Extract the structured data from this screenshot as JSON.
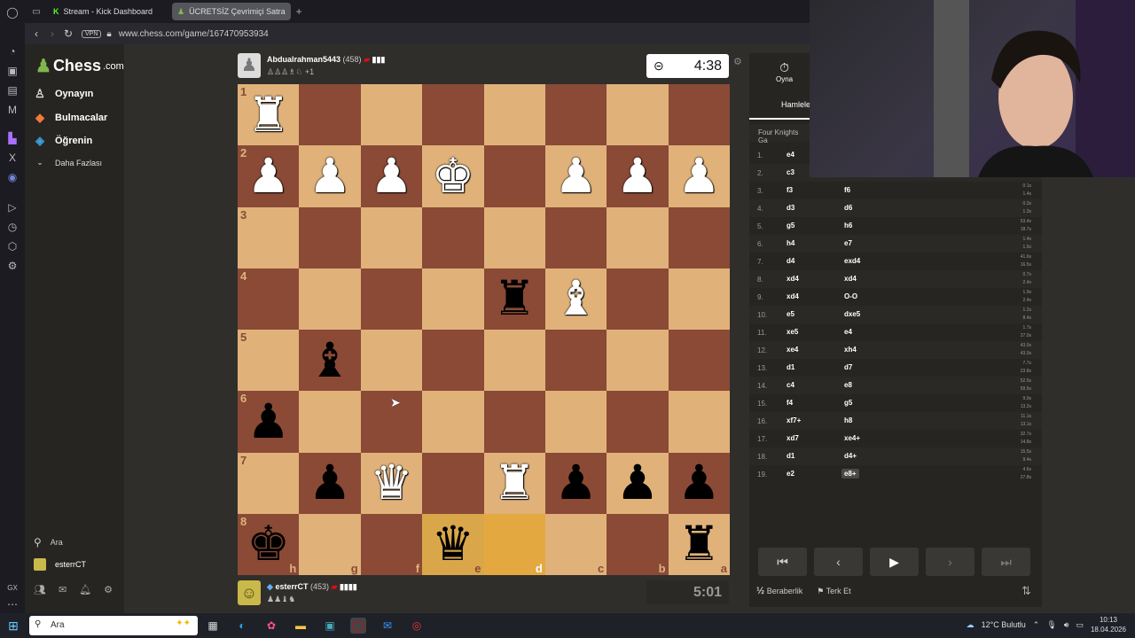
{
  "browser": {
    "tabs": [
      {
        "label": "Stream - Kick Dashboard",
        "active": false
      },
      {
        "label": "ÜCRETSİZ Çevrimiçi Satra",
        "active": true
      }
    ],
    "vpn": "VPN",
    "url": "www.chess.com/game/167470953934"
  },
  "sidebar": {
    "logo": "Chess",
    "logo_suffix": ".com",
    "items": [
      {
        "label": "Oynayın",
        "icon": "pawn-board-icon"
      },
      {
        "label": "Bulmacalar",
        "icon": "puzzle-icon"
      },
      {
        "label": "Öğrenin",
        "icon": "learn-cap-icon"
      },
      {
        "label": "Daha Fazlası",
        "icon": "chevron-down-icon"
      }
    ],
    "search_label": "Ara",
    "user": "esterrCT"
  },
  "top_player": {
    "name": "Abdualrahman5443",
    "rating": "(458)",
    "captured_extra": "+1",
    "clock": "4:38"
  },
  "bottom_player": {
    "name": "esterrCT",
    "rating": "(453)",
    "clock": "5:01"
  },
  "board": {
    "ranks": [
      "1",
      "2",
      "3",
      "4",
      "5",
      "6",
      "7",
      "8"
    ],
    "files": [
      "h",
      "g",
      "f",
      "e",
      "d",
      "c",
      "b",
      "a"
    ],
    "rows": [
      [
        "wR",
        "",
        "",
        "",
        "",
        "",
        "",
        ""
      ],
      [
        "wP",
        "wP",
        "wP",
        "wK",
        "",
        "wP",
        "wP",
        "wP"
      ],
      [
        "",
        "",
        "",
        "",
        "",
        "",
        "",
        ""
      ],
      [
        "",
        "",
        "",
        "",
        "bR",
        "wB",
        "",
        ""
      ],
      [
        "",
        "bB",
        "",
        "",
        "",
        "",
        "",
        ""
      ],
      [
        "bP",
        "",
        "",
        "",
        "",
        "",
        "",
        ""
      ],
      [
        "",
        "bP",
        "wQ",
        "",
        "wR",
        "bP",
        "bP",
        "bP"
      ],
      [
        "bK",
        "",
        "",
        "bQ",
        "",
        "",
        "",
        "bR"
      ]
    ],
    "highlight": [
      "7-3",
      "7-4"
    ]
  },
  "panel": {
    "play_label": "Oyna",
    "moves_tab": "Hamleler",
    "opening": "Four Knights Ga",
    "moves": [
      {
        "n": "1.",
        "w": "e4",
        "b": "",
        "tw": "",
        "tb": ""
      },
      {
        "n": "2.",
        "w": "c3",
        "b": "",
        "tw": "",
        "tb": ""
      },
      {
        "n": "3.",
        "w": "f3",
        "b": "f6",
        "tw": "0.1s",
        "tb": "1.4s"
      },
      {
        "n": "4.",
        "w": "d3",
        "b": "d6",
        "tw": "0.3s",
        "tb": "1.3s"
      },
      {
        "n": "5.",
        "w": "g5",
        "b": "h6",
        "tw": "53.4s",
        "tb": "18.7s"
      },
      {
        "n": "6.",
        "w": "h4",
        "b": "e7",
        "tw": "1.4s",
        "tb": "1.5s"
      },
      {
        "n": "7.",
        "w": "d4",
        "b": "exd4",
        "tw": "41.6s",
        "tb": "16.5s"
      },
      {
        "n": "8.",
        "w": "xd4",
        "b": "xd4",
        "tw": "0.7s",
        "tb": "2.4s"
      },
      {
        "n": "9.",
        "w": "xd4",
        "b": "O-O",
        "tw": "1.9s",
        "tb": "2.4s"
      },
      {
        "n": "10.",
        "w": "e5",
        "b": "dxe5",
        "tw": "1.2s",
        "tb": "8.4s"
      },
      {
        "n": "11.",
        "w": "xe5",
        "b": "e4",
        "tw": "1.7s",
        "tb": "27.0s"
      },
      {
        "n": "12.",
        "w": "xe4",
        "b": "xh4",
        "tw": "43.0s",
        "tb": "43.0s"
      },
      {
        "n": "13.",
        "w": "d1",
        "b": "d7",
        "tw": "7.7s",
        "tb": "23.8s"
      },
      {
        "n": "14.",
        "w": "c4",
        "b": "e8",
        "tw": "52.5s",
        "tb": "59.5s"
      },
      {
        "n": "15.",
        "w": "f4",
        "b": "g5",
        "tw": "9.0s",
        "tb": "13.2s"
      },
      {
        "n": "16.",
        "w": "xf7+",
        "b": "h8",
        "tw": "11.1s",
        "tb": "13.1s"
      },
      {
        "n": "17.",
        "w": "xd7",
        "b": "xe4+",
        "tw": "32.7s",
        "tb": "14.8s"
      },
      {
        "n": "18.",
        "w": "d1",
        "b": "d4+",
        "tw": "15.5s",
        "tb": "9.4s"
      },
      {
        "n": "19.",
        "w": "e2",
        "b": "e8+",
        "tw": "4.6s",
        "tb": "27.8s"
      }
    ],
    "draw_label": "Beraberlik",
    "resign_label": "Terk Et"
  },
  "taskbar": {
    "search": "Ara",
    "weather": "12°C  Bulutlu",
    "time": "10:13",
    "date": "18.04.2026"
  }
}
